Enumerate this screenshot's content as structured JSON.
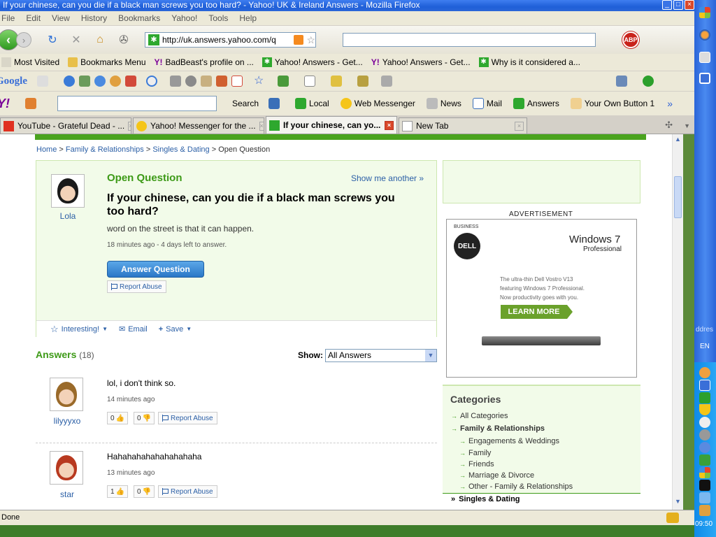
{
  "window": {
    "title": "If your chinese, can you die if a black man screws you too hard? - Yahoo! UK & Ireland Answers - Mozilla Firefox"
  },
  "menu": [
    "File",
    "Edit",
    "View",
    "History",
    "Bookmarks",
    "Yahoo!",
    "Tools",
    "Help"
  ],
  "nav": {
    "url": "http://uk.answers.yahoo.com/q",
    "abp_label": "ABP"
  },
  "bookmarks": [
    "Most Visited",
    "Bookmarks Menu",
    "BadBeast's profile on ...",
    "Yahoo! Answers - Get...",
    "Yahoo! Answers - Get...",
    "Why is it considered a..."
  ],
  "googlebar": {
    "logo": "Google"
  },
  "yahoobar": {
    "logo": "Y!",
    "buttons": [
      "Search",
      "Local",
      "Web Messenger",
      "News",
      "Mail",
      "Answers",
      "Your Own Button 1"
    ]
  },
  "tabs": [
    {
      "label": "YouTube - Grateful Dead - ...",
      "active": false
    },
    {
      "label": "Yahoo! Messenger for the ...",
      "active": false
    },
    {
      "label": "If your chinese, can yo...",
      "active": true
    },
    {
      "label": "New Tab",
      "active": false
    }
  ],
  "breadcrumb": {
    "items": [
      "Home",
      "Family & Relationships",
      "Singles & Dating"
    ],
    "current": "Open Question",
    "sep": ">"
  },
  "question": {
    "label": "Open Question",
    "show_another": "Show me another »",
    "asker": "Lola",
    "title": "If your chinese, can you die if a black man screws you too hard?",
    "body": "word on the street is that it can happen.",
    "meta": "18 minutes ago - 4 days left to answer.",
    "answer_button": "Answer Question",
    "report_abuse": "Report Abuse",
    "actions": {
      "interesting": "Interesting!",
      "email": "Email",
      "save": "Save"
    }
  },
  "answers": {
    "title": "Answers",
    "count": "(18)",
    "show_label": "Show:",
    "show_value": "All Answers",
    "items": [
      {
        "user": "lilyyyxo",
        "text": "lol, i don't think so.",
        "meta": "14 minutes ago",
        "up": "0",
        "down": "0",
        "report": "Report Abuse"
      },
      {
        "user": "star",
        "text": "Hahahahahahahahahaha",
        "meta": "13 minutes ago",
        "up": "1",
        "down": "0",
        "report": "Report Abuse"
      }
    ]
  },
  "ad": {
    "label": "ADVERTISEMENT",
    "business": "BUSINESS",
    "brand": "DELL",
    "windows": "Windows 7",
    "windows_edition": "Professional",
    "copy": [
      "The ultra-thin Dell Vostro V13",
      "featuring Windows 7 Professional.",
      "Now productivity goes with you."
    ],
    "cta": "LEARN MORE"
  },
  "categories": {
    "title": "Categories",
    "items": [
      {
        "label": "All Categories",
        "bold": false
      },
      {
        "label": "Family & Relationships",
        "bold": true
      },
      {
        "label": "Engagements & Weddings",
        "bold": false
      },
      {
        "label": "Family",
        "bold": false
      },
      {
        "label": "Friends",
        "bold": false
      },
      {
        "label": "Marriage & Divorce",
        "bold": false
      },
      {
        "label": "Other - Family & Relationships",
        "bold": false
      }
    ],
    "selected": "Singles & Dating"
  },
  "status": {
    "text": "Done"
  },
  "systray": {
    "address_fragment": "ddres",
    "lang": "EN",
    "clock": "09:50"
  },
  "colors": {
    "accent_green": "#3d9a17",
    "link_blue": "#2b5fa6",
    "panel_bg": "#f2fbe9",
    "xp_blue": "#2a64d8"
  }
}
